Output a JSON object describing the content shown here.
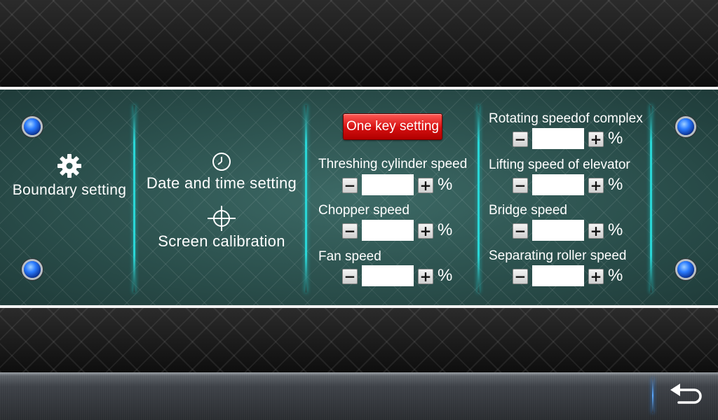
{
  "menu": {
    "boundary_setting": "Boundary setting",
    "date_time_setting": "Date and time setting",
    "screen_calibration": "Screen calibration"
  },
  "one_key_setting": "One key setting",
  "parameters": [
    {
      "label": "Threshing cylinder speed",
      "value": "",
      "unit": "%"
    },
    {
      "label": "Chopper speed",
      "value": "",
      "unit": "%"
    },
    {
      "label": "Fan speed",
      "value": "",
      "unit": "%"
    },
    {
      "label": "Rotating speedof complex",
      "value": "",
      "unit": "%"
    },
    {
      "label": "Lifting speed of elevator",
      "value": "",
      "unit": "%"
    },
    {
      "label": "Bridge speed",
      "value": "",
      "unit": "%"
    },
    {
      "label": "Separating roller speed",
      "value": "",
      "unit": "%"
    }
  ],
  "stepper_symbols": {
    "minus": "−",
    "plus": "+"
  },
  "icons": {
    "boundary": "gear-icon",
    "date_time": "clock-icon",
    "calibration": "crosshair-icon",
    "back": "back-arrow-icon",
    "bolts": "blue-bolt-icon"
  },
  "colors": {
    "panel": "#2e5552",
    "divider_glow": "#2ad6d6",
    "button_red": "#d40f10",
    "bolt_blue": "#2a7bff"
  }
}
